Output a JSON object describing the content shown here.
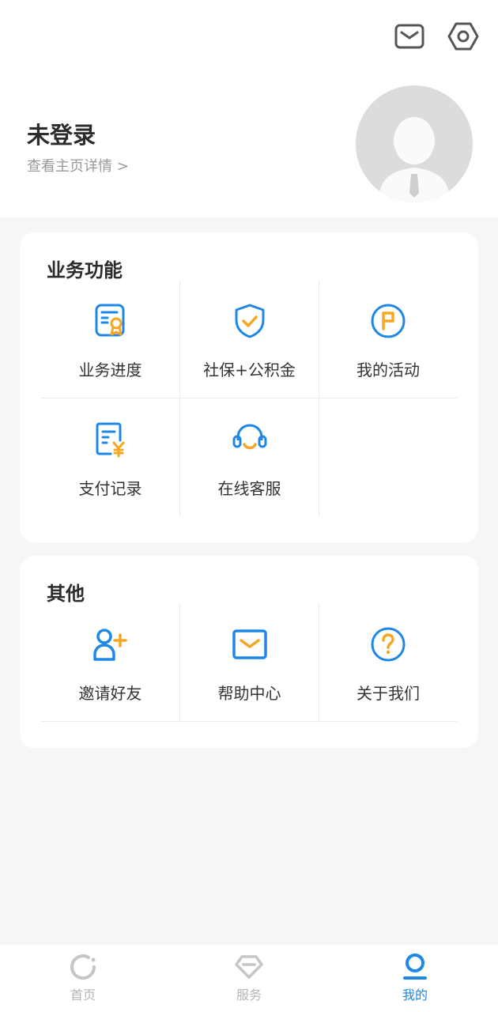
{
  "header": {
    "name": "未登录",
    "subtitle": "查看主页详情 >"
  },
  "icons": {
    "message": "mail-icon",
    "settings": "hexagon-gear-icon",
    "avatar": "default-avatar-icon"
  },
  "colors": {
    "accent_blue": "#1f87e5",
    "accent_orange": "#f5a623",
    "tab_inactive": "#b5b5b5"
  },
  "business": {
    "title": "业务功能",
    "items": [
      {
        "label": "业务进度",
        "icon": "certificate-icon"
      },
      {
        "label": "社保+公积金",
        "icon": "shield-check-icon"
      },
      {
        "label": "我的活动",
        "icon": "flag-circle-icon"
      },
      {
        "label": "支付记录",
        "icon": "yuan-receipt-icon"
      },
      {
        "label": "在线客服",
        "icon": "headset-icon"
      }
    ]
  },
  "other": {
    "title": "其他",
    "items": [
      {
        "label": "邀请好友",
        "icon": "add-user-icon"
      },
      {
        "label": "帮助中心",
        "icon": "envelope-icon"
      },
      {
        "label": "关于我们",
        "icon": "question-circle-icon"
      }
    ]
  },
  "tabbar": {
    "tabs": [
      {
        "label": "首页",
        "icon": "home-ring-icon",
        "active": false
      },
      {
        "label": "服务",
        "icon": "diamond-icon",
        "active": false
      },
      {
        "label": "我的",
        "icon": "profile-icon",
        "active": true
      }
    ]
  }
}
